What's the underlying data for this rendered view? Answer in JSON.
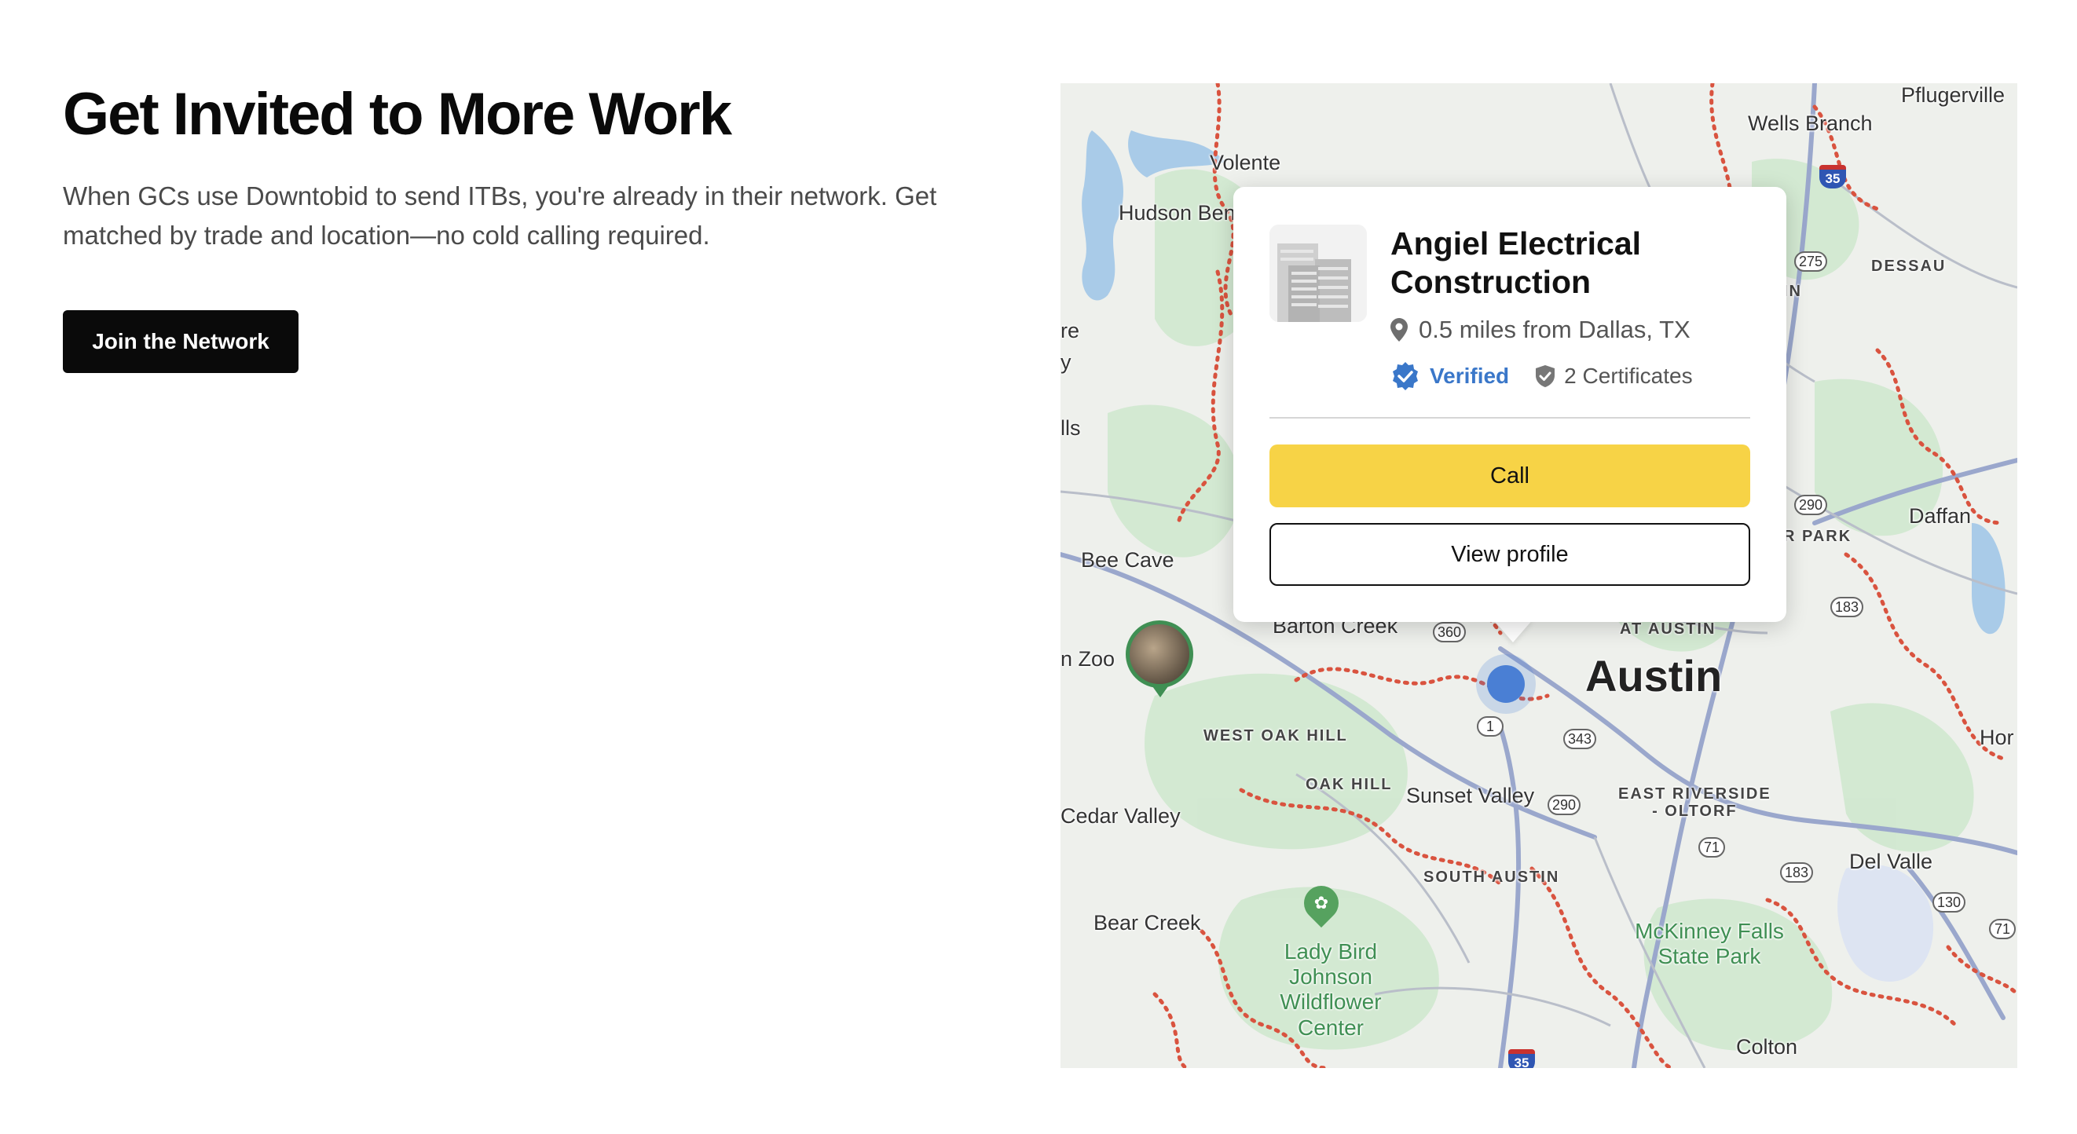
{
  "hero": {
    "title": "Get Invited to More Work",
    "subtitle": "When GCs use Downtobid to send ITBs, you're already in their network. Get matched by trade and location—no cold calling required.",
    "cta_label": "Join the Network"
  },
  "map": {
    "places": {
      "pflugerville": "Pflugerville",
      "wells_branch": "Wells Branch",
      "volente": "Volente",
      "hudson_bend": "Hudson Ben",
      "dessau": "DESSAU",
      "daffan": "Daffan",
      "park_frag": "R PARK",
      "in_frag": "IN",
      "re_frag": "re",
      "y_frag": "y",
      "lls_frag": "lls",
      "bee_cave": "Bee Cave",
      "barton_creek": "Barton Creek",
      "at_austin": "AT AUSTIN",
      "austin": "Austin",
      "zoo": "n Zoo",
      "hor": "Hor",
      "west_oak_hill": "WEST OAK HILL",
      "oak_hill": "OAK HILL",
      "sunset_valley": "Sunset Valley",
      "east_riverside": "EAST RIVERSIDE\n- OLTORF",
      "cedar_valley": "Cedar Valley",
      "south_austin": "SOUTH AUSTIN",
      "del_valle": "Del Valle",
      "bear_creek": "Bear Creek",
      "lady_bird": "Lady Bird Johnson Wildflower Center",
      "mckinney": "McKinney Falls State Park",
      "colton": "Colton"
    },
    "routes": {
      "r35a": "35",
      "r275": "275",
      "r290a": "290",
      "r183a": "183",
      "r360": "360",
      "r1": "1",
      "r343": "343",
      "r290b": "290",
      "r71a": "71",
      "r183b": "183",
      "r130": "130",
      "r71b": "71",
      "r35b": "35",
      "r35c": "35"
    }
  },
  "card": {
    "company": "Angiel Electrical Construction",
    "distance": "0.5 miles from Dallas, TX",
    "verified_label": "Verified",
    "certificates_label": "2 Certificates",
    "call_label": "Call",
    "view_profile_label": "View profile"
  },
  "colors": {
    "cta_bg": "#0a0a0a",
    "call_bg": "#f7d346",
    "verified": "#3a77c9",
    "pin": "#4a7fd4",
    "boundary": "#d9533f"
  },
  "icons": {
    "location": "location-pin-icon",
    "verified": "verified-badge-icon",
    "certificate": "shield-check-icon"
  }
}
